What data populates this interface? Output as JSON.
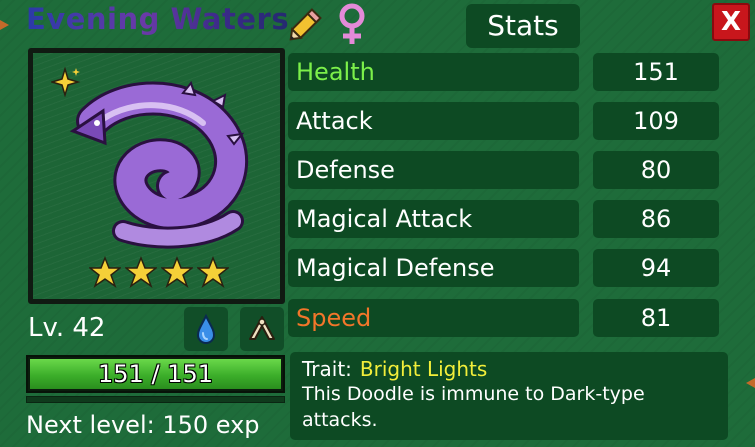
{
  "doodle": {
    "name": "Evening Waters",
    "gender": "female",
    "level_text": "Lv. 42",
    "type_icons": [
      "water-drop-icon",
      "ability-icon"
    ],
    "star_count": 4,
    "variant_sparkle": true
  },
  "hp": {
    "text": "151 / 151",
    "fraction": 1.0
  },
  "exp": {
    "next_level_text": "Next level: 150 exp",
    "fraction": 0.0
  },
  "header": {
    "stats_tab_label": "Stats",
    "close_label": "X"
  },
  "stats": [
    {
      "label": "Health",
      "value": "151",
      "label_color": "#7cf04a"
    },
    {
      "label": "Attack",
      "value": "109",
      "label_color": "#ffffff"
    },
    {
      "label": "Defense",
      "value": "80",
      "label_color": "#ffffff"
    },
    {
      "label": "Magical Attack",
      "value": "86",
      "label_color": "#ffffff"
    },
    {
      "label": "Magical Defense",
      "value": "94",
      "label_color": "#ffffff"
    },
    {
      "label": "Speed",
      "value": "81",
      "label_color": "#f2762a"
    }
  ],
  "trait": {
    "prefix": "Trait:",
    "name": "Bright Lights",
    "description": "This Doodle is immune to Dark-type attacks."
  },
  "colors": {
    "background": "#1e6c3a",
    "panel": "#0d4a23",
    "close_button": "#c8161c",
    "trait_name": "#f2ee3a",
    "hp_fill": "#3cae2a",
    "star": "#f5d038",
    "creature": "#9a6ad6"
  }
}
